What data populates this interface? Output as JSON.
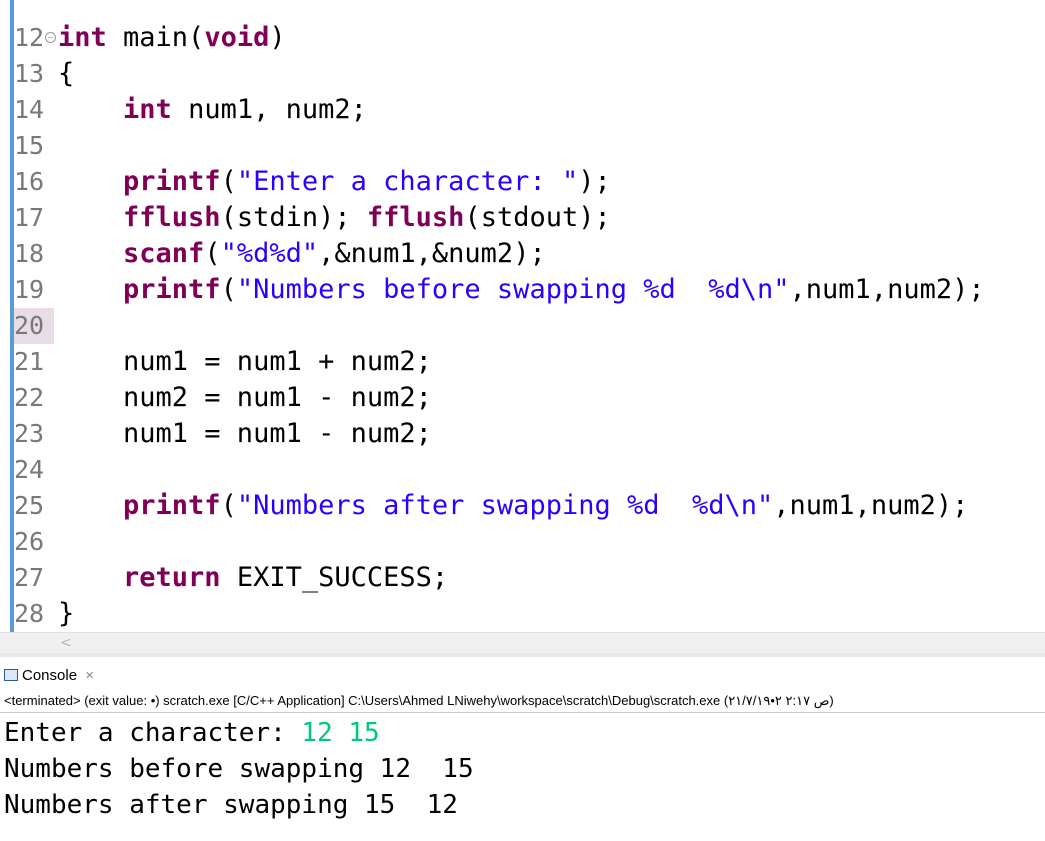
{
  "editor": {
    "lines": [
      {
        "num": "12",
        "parts": [
          {
            "t": "int",
            "c": "kw"
          },
          {
            "t": " main(",
            "c": ""
          },
          {
            "t": "void",
            "c": "kw"
          },
          {
            "t": ")",
            "c": ""
          }
        ]
      },
      {
        "num": "13",
        "parts": [
          {
            "t": "{",
            "c": ""
          }
        ]
      },
      {
        "num": "14",
        "parts": [
          {
            "t": "    ",
            "c": ""
          },
          {
            "t": "int",
            "c": "kw"
          },
          {
            "t": " num1, num2;",
            "c": ""
          }
        ]
      },
      {
        "num": "15",
        "parts": []
      },
      {
        "num": "16",
        "parts": [
          {
            "t": "    ",
            "c": ""
          },
          {
            "t": "printf",
            "c": "kw"
          },
          {
            "t": "(",
            "c": ""
          },
          {
            "t": "\"Enter a character: \"",
            "c": "str"
          },
          {
            "t": ");",
            "c": ""
          }
        ]
      },
      {
        "num": "17",
        "parts": [
          {
            "t": "    ",
            "c": ""
          },
          {
            "t": "fflush",
            "c": "kw"
          },
          {
            "t": "(stdin); ",
            "c": ""
          },
          {
            "t": "fflush",
            "c": "kw"
          },
          {
            "t": "(stdout);",
            "c": ""
          }
        ]
      },
      {
        "num": "18",
        "parts": [
          {
            "t": "    ",
            "c": ""
          },
          {
            "t": "scanf",
            "c": "kw"
          },
          {
            "t": "(",
            "c": ""
          },
          {
            "t": "\"%d%d\"",
            "c": "str"
          },
          {
            "t": ",&num1,&num2);",
            "c": ""
          }
        ]
      },
      {
        "num": "19",
        "parts": [
          {
            "t": "    ",
            "c": ""
          },
          {
            "t": "printf",
            "c": "kw"
          },
          {
            "t": "(",
            "c": ""
          },
          {
            "t": "\"Numbers before swapping %d  %d\\n\"",
            "c": "str"
          },
          {
            "t": ",num1,num2);",
            "c": ""
          }
        ]
      },
      {
        "num": "20",
        "parts": [],
        "highlight": true
      },
      {
        "num": "21",
        "parts": [
          {
            "t": "    num1 = num1 + num2;",
            "c": ""
          }
        ]
      },
      {
        "num": "22",
        "parts": [
          {
            "t": "    num2 = num1 - num2;",
            "c": ""
          }
        ]
      },
      {
        "num": "23",
        "parts": [
          {
            "t": "    num1 = num1 - num2;",
            "c": ""
          }
        ]
      },
      {
        "num": "24",
        "parts": []
      },
      {
        "num": "25",
        "parts": [
          {
            "t": "    ",
            "c": ""
          },
          {
            "t": "printf",
            "c": "kw"
          },
          {
            "t": "(",
            "c": ""
          },
          {
            "t": "\"Numbers after swapping %d  %d\\n\"",
            "c": "str"
          },
          {
            "t": ",num1,num2);",
            "c": ""
          }
        ]
      },
      {
        "num": "26",
        "parts": []
      },
      {
        "num": "27",
        "parts": [
          {
            "t": "    ",
            "c": ""
          },
          {
            "t": "return",
            "c": "kw"
          },
          {
            "t": " EXIT_SUCCESS;",
            "c": ""
          }
        ]
      },
      {
        "num": "28",
        "parts": [
          {
            "t": "}",
            "c": ""
          }
        ]
      }
    ],
    "scroll_arrow": "<"
  },
  "console": {
    "tab_label": "Console",
    "close_glyph": "✕",
    "status": "<terminated> (exit value: •) scratch.exe [C/C++ Application] C:\\Users\\Ahmed LNiwehy\\workspace\\scratch\\Debug\\scratch.exe (ص ٢:١٧ ٢•٢١/٧/١٩)",
    "output": [
      {
        "text": "Enter a character: ",
        "input": "12 15"
      },
      {
        "text": "Numbers before swapping 12  15",
        "input": ""
      },
      {
        "text": "Numbers after swapping 15  12",
        "input": ""
      }
    ]
  },
  "colors": {
    "keyword": "#7f0055",
    "string": "#2a00ff",
    "user_input": "#00c87a"
  }
}
